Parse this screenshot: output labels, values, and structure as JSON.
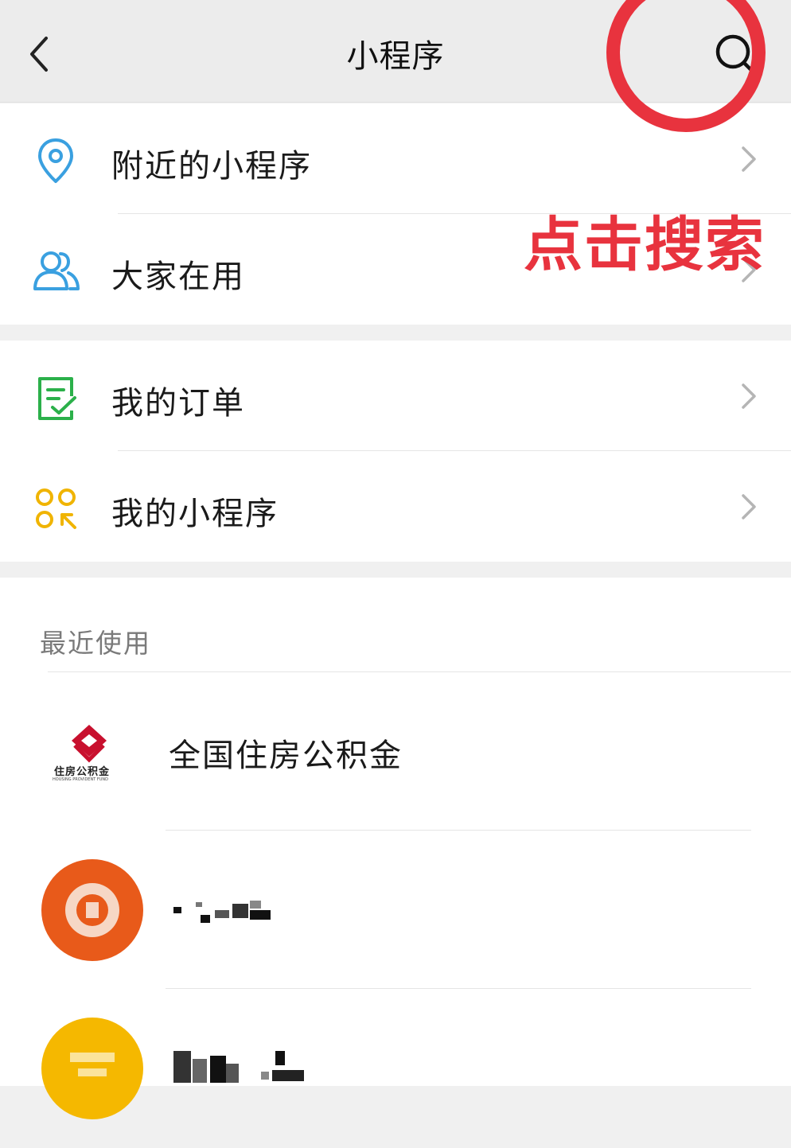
{
  "header": {
    "title": "小程序",
    "back_icon": "chevron-left-icon",
    "search_icon": "search-icon"
  },
  "annotation": {
    "text": "点击搜索",
    "color": "#e8333e"
  },
  "menu_group_1": [
    {
      "label": "附近的小程序",
      "icon": "location-pin-icon",
      "icon_color": "#3aa0e0"
    },
    {
      "label": "大家在用",
      "icon": "users-icon",
      "icon_color": "#3aa0e0"
    }
  ],
  "menu_group_2": [
    {
      "label": "我的订单",
      "icon": "order-check-icon",
      "icon_color": "#2bb04a"
    },
    {
      "label": "我的小程序",
      "icon": "apps-grid-icon",
      "icon_color": "#f0b400"
    }
  ],
  "recent": {
    "section_title": "最近使用",
    "items": [
      {
        "label": "全国住房公积金",
        "logo_text": "住房公积金",
        "logo_subtext": "HOUSING PROVIDENT FUND",
        "logo_color": "#c8102e"
      },
      {
        "label": "",
        "logo": "orange-circle-logo"
      },
      {
        "label": "",
        "logo": "yellow-circle-logo"
      }
    ]
  }
}
